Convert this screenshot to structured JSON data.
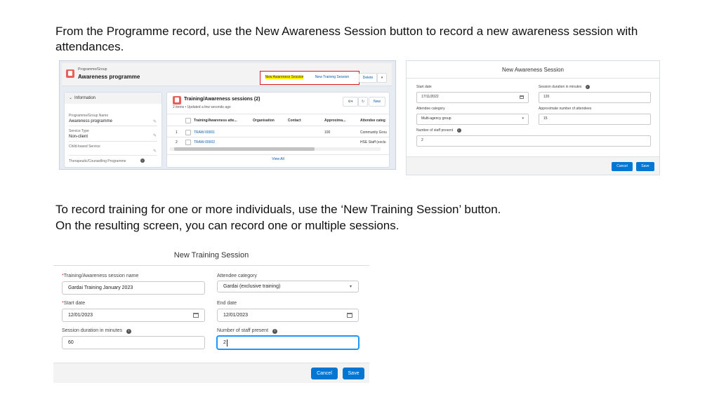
{
  "slide": {
    "intro_line1": "From the Programme record, use the New Awareness Session button to record a new awareness session with",
    "intro_line2": "attendances.",
    "training_line1": "To record training for one or more individuals, use the ‘New Training Session’ button.",
    "training_line2": "On the resulting screen, you can record one or multiple sessions."
  },
  "programme_record": {
    "object_label": "Programme/Group",
    "record_name": "Awareness programme",
    "buttons": [
      "New Awareness Session",
      "New Training Session",
      "Delete"
    ],
    "info_section": "Information",
    "fields": [
      {
        "label": "Programme/Group Name",
        "value": "Awareness programme"
      },
      {
        "label": "Service Type",
        "value": "Non-client"
      },
      {
        "label": "Child-based Service",
        "value": ""
      },
      {
        "label": "Therapeutic/Counselling Programme",
        "value": ""
      }
    ],
    "related_list": {
      "title": "Training/Awareness sessions (2)",
      "meta": "2 items • Updated a few seconds ago",
      "new_button": "New",
      "columns": [
        "Training/Awareness atte...",
        "Organisation",
        "Contact",
        "Approxima...",
        "Attendee categ"
      ],
      "rows": [
        {
          "num": "1",
          "name": "TRAW-00001",
          "approx": "100",
          "category": "Community Grou"
        },
        {
          "num": "2",
          "name": "TRAW-00002",
          "approx": "",
          "category": "HSE Staff (exclu"
        }
      ],
      "view_all": "View All"
    }
  },
  "awareness_modal": {
    "title": "New Awareness Session",
    "start_date_label": "Start date",
    "start_date_value": "17/11/2022",
    "duration_label": "Session duration in minutes",
    "duration_value": "120",
    "attendee_category_label": "Attendee category",
    "attendee_category_value": "Multi-agency group",
    "approx_attendees_label": "Approximate number of attendees",
    "approx_attendees_value": "15",
    "staff_label": "Number of staff present",
    "staff_value": "2",
    "cancel": "Cancel",
    "save": "Save"
  },
  "training_modal": {
    "title": "New Training Session",
    "session_name_label": "Training/Awareness session name",
    "session_name_value": "Gardai Training January 2023",
    "attendee_category_label": "Attendee category",
    "attendee_category_value": "Gardai (exclusive training)",
    "start_date_label": "Start date",
    "start_date_value": "12/01/2023",
    "end_date_label": "End date",
    "end_date_value": "12/01/2023",
    "duration_label": "Session duration in minutes",
    "duration_value": "60",
    "staff_label": "Number of staff present",
    "staff_value": "2",
    "cancel": "Cancel",
    "save": "Save"
  },
  "colors": {
    "brand_blue": "#0176d3",
    "highlight_red": "#d31a1a",
    "highlight_yellow": "#fff200",
    "object_icon": "#e8605b"
  }
}
